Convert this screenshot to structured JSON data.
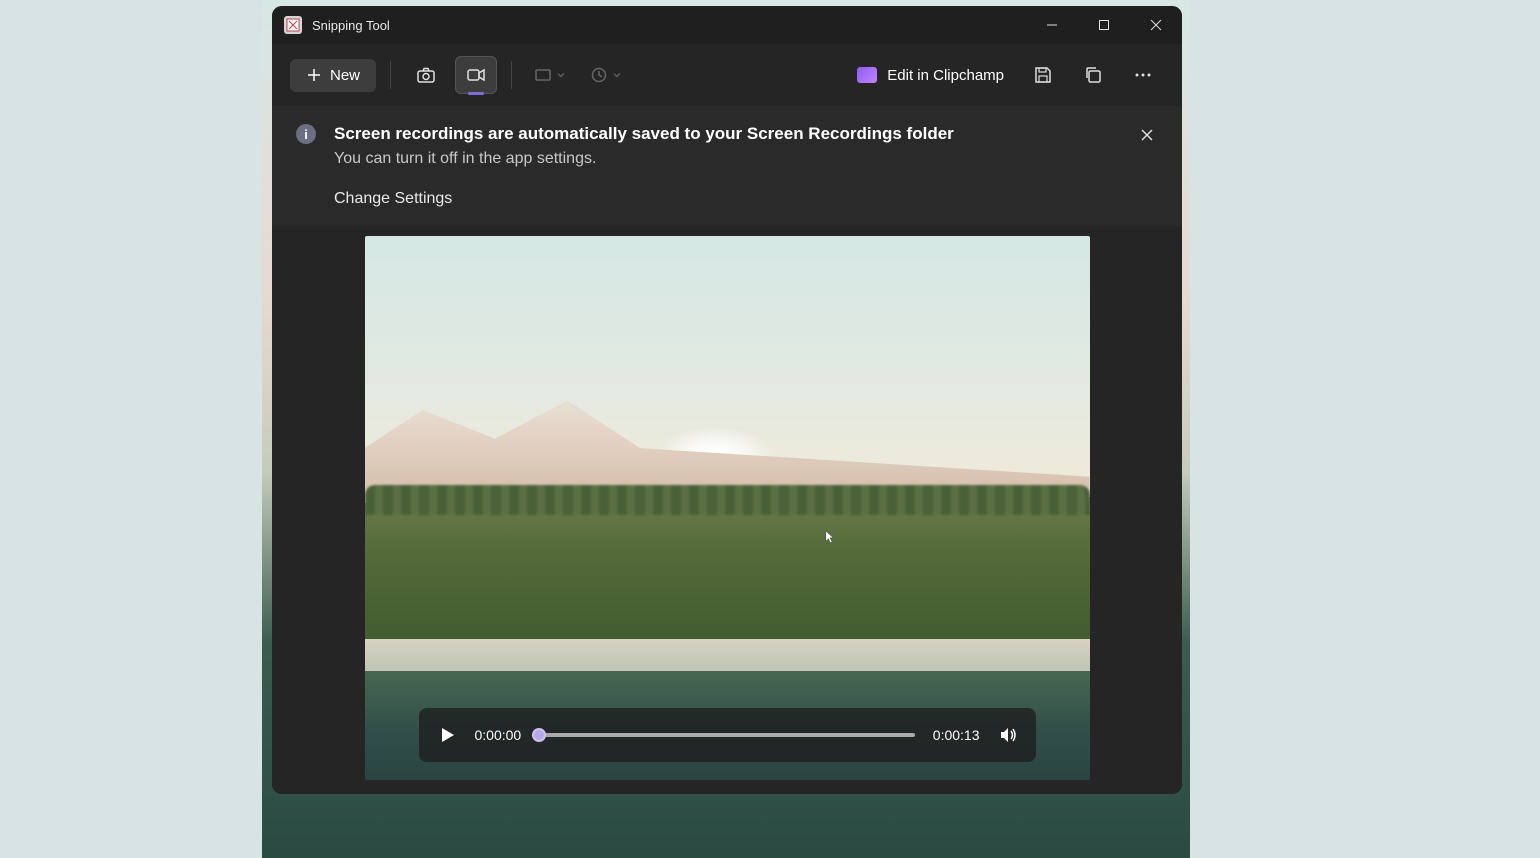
{
  "window": {
    "title": "Snipping Tool"
  },
  "toolbar": {
    "new_label": "New",
    "clipchamp_label": "Edit in Clipchamp"
  },
  "banner": {
    "title": "Screen recordings are automatically saved to your Screen Recordings folder",
    "subtitle": "You can turn it off in the app settings.",
    "link": "Change Settings"
  },
  "player": {
    "current_time": "0:00:00",
    "total_time": "0:00:13",
    "progress_percent": 0
  }
}
